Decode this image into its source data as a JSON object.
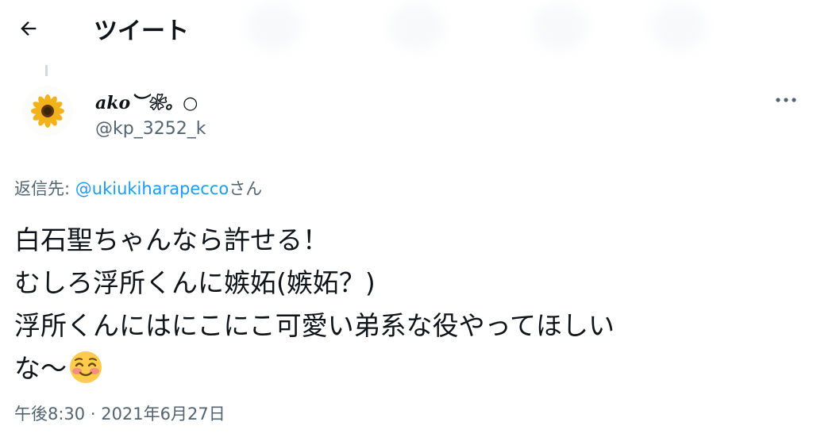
{
  "header": {
    "title": "ツイート",
    "back_icon": "arrow-left-icon"
  },
  "author": {
    "display_name": "ako︶❀。○",
    "handle": "@kp_3252_k",
    "avatar_icon": "sunflower-icon"
  },
  "menu": {
    "more_icon": "ellipsis-icon",
    "label": "•••"
  },
  "reply": {
    "prefix": "返信先: ",
    "mention": "@ukiukiharapecco",
    "suffix": "さん"
  },
  "tweet": {
    "lines": [
      "白石聖ちゃんなら許せる！",
      "むしろ浮所くんに嫉妬(嫉妬？)",
      "浮所くんにはにこにこ可愛い弟系な役やってほしい",
      "な〜"
    ],
    "emoji": "smiling-face-icon"
  },
  "meta": {
    "time": "午後8:30",
    "separator": " · ",
    "date": "2021年6月27日"
  },
  "colors": {
    "text": "#0f1419",
    "secondary": "#536471",
    "link": "#1d9bf0"
  }
}
